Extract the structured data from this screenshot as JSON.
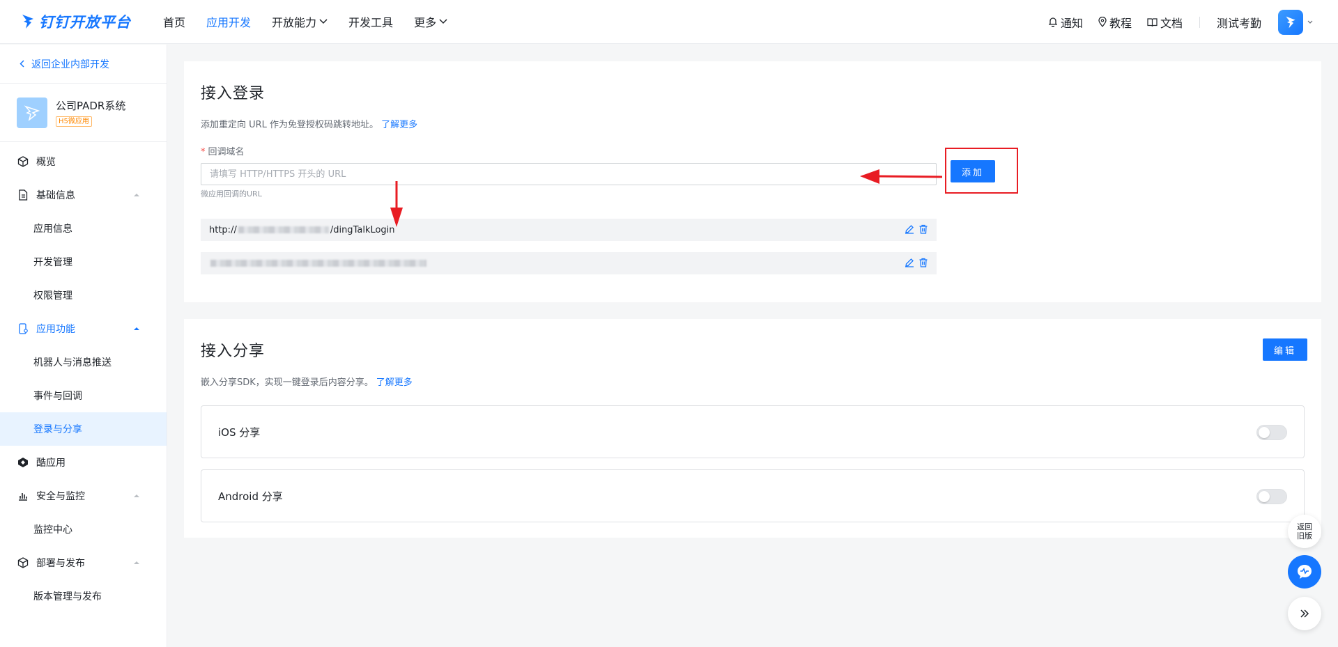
{
  "header": {
    "logo_text": "钉钉开放平台",
    "nav": [
      {
        "label": "首页"
      },
      {
        "label": "应用开发",
        "active": true
      },
      {
        "label": "开放能力"
      },
      {
        "label": "开发工具"
      },
      {
        "label": "更多"
      }
    ],
    "right": {
      "notify": "通知",
      "tutorial": "教程",
      "docs": "文档",
      "org": "测试考勤"
    }
  },
  "sidebar": {
    "back": "返回企业内部开发",
    "app": {
      "name": "公司PADR系统",
      "tag": "H5微应用"
    },
    "menu": {
      "overview": "概览",
      "basic": "基础信息",
      "app_info": "应用信息",
      "dev_manage": "开发管理",
      "perm_manage": "权限管理",
      "features": "应用功能",
      "robot": "机器人与消息推送",
      "events": "事件与回调",
      "login_share": "登录与分享",
      "cool_app": "酷应用",
      "security": "安全与监控",
      "monitor": "监控中心",
      "deploy": "部署与发布",
      "version": "版本管理与发布"
    }
  },
  "login": {
    "title": "接入登录",
    "desc": "添加重定向 URL 作为免登授权码跳转地址。",
    "learn_more": "了解更多",
    "field_label": "回调域名",
    "placeholder": "请填写 HTTP/HTTPS 开头的 URL",
    "hint": "微应用回调的URL",
    "add_button": "添加",
    "urls": [
      {
        "prefix": "http://",
        "suffix": "/dingTalkLogin"
      }
    ]
  },
  "share": {
    "title": "接入分享",
    "desc": "嵌入分享SDK，实现一键登录后内容分享。",
    "learn_more": "了解更多",
    "edit_button": "编辑",
    "ios": "iOS 分享",
    "android": "Android 分享"
  },
  "float": {
    "old_version_1": "返回",
    "old_version_2": "旧版"
  },
  "colors": {
    "accent": "#1677ff",
    "annotation": "#e81c23"
  }
}
